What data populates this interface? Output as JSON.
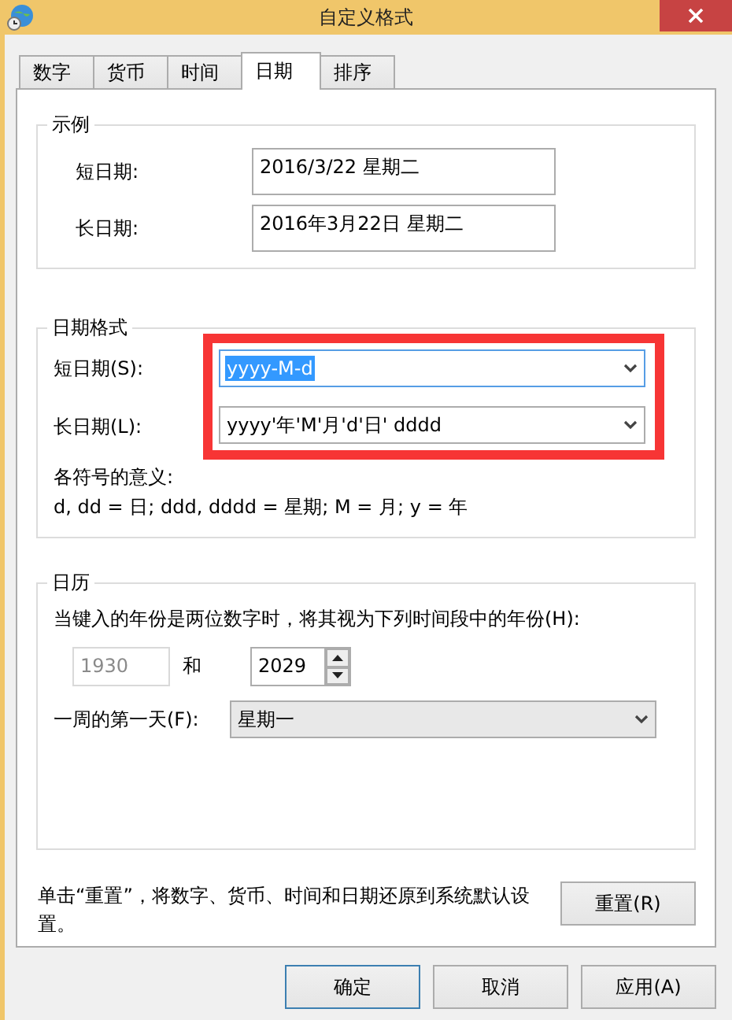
{
  "window": {
    "title": "自定义格式"
  },
  "tabs": [
    {
      "label": "数字",
      "selected": false
    },
    {
      "label": "货币",
      "selected": false
    },
    {
      "label": "时间",
      "selected": false
    },
    {
      "label": "日期",
      "selected": true
    },
    {
      "label": "排序",
      "selected": false
    }
  ],
  "example": {
    "title": "示例",
    "rows": [
      {
        "label": "短日期:",
        "value": "2016/3/22 星期二"
      },
      {
        "label": "长日期:",
        "value": "2016年3月22日 星期二"
      }
    ]
  },
  "date_format": {
    "title": "日期格式",
    "highlighted": true,
    "rows": [
      {
        "label": "短日期(S):",
        "value": "yyyy-M-d",
        "selected": true
      },
      {
        "label": "长日期(L):",
        "value": "yyyy'年'M'月'd'日' dddd",
        "selected": false
      }
    ],
    "legend_title": "各符号的意义:",
    "legend": "d, dd = 日;  ddd, dddd = 星期;  M = 月;  y = 年"
  },
  "calendar": {
    "title": "日历",
    "two_digit_label": "当键入的年份是两位数字时，将其视为下列时间段中的年份(H):",
    "from_year": "1930",
    "and_label": "和",
    "to_year": "2029",
    "first_day_label": "一周的第一天(F):",
    "first_day": "星期一"
  },
  "reset_note": "单击“重置”，将数字、货币、时间和日期还原到系统默认设置。",
  "reset_button": "重置(R)",
  "buttons": [
    {
      "label": "确定",
      "focused": true
    },
    {
      "label": "取消",
      "focused": false
    },
    {
      "label": "应用(A)",
      "focused": false
    }
  ]
}
